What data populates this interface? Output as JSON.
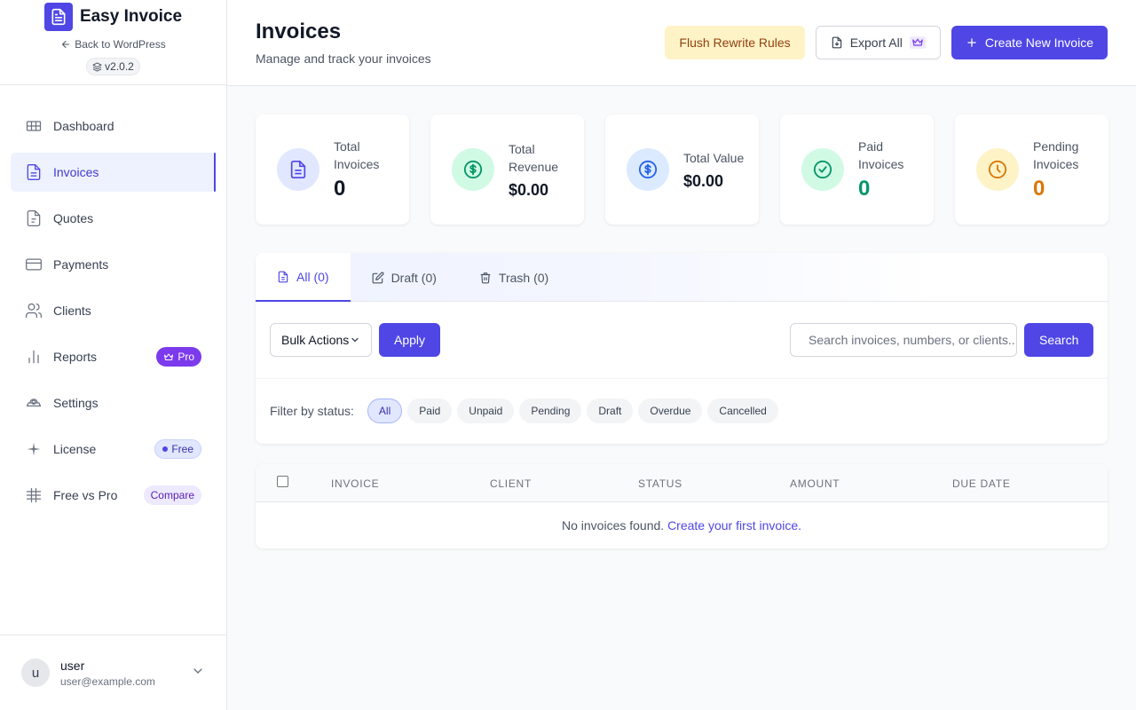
{
  "brand": {
    "name": "Easy Invoice",
    "back_label": "Back to WordPress",
    "version": "v2.0.2"
  },
  "sidebar": {
    "items": [
      {
        "label": "Dashboard",
        "icon": "dashboard-icon"
      },
      {
        "label": "Invoices",
        "icon": "invoice-icon",
        "active": true
      },
      {
        "label": "Quotes",
        "icon": "quote-icon"
      },
      {
        "label": "Payments",
        "icon": "credit-card-icon"
      },
      {
        "label": "Clients",
        "icon": "users-icon"
      },
      {
        "label": "Reports",
        "icon": "bar-chart-icon",
        "badge": "Pro"
      },
      {
        "label": "Settings",
        "icon": "settings-icon"
      },
      {
        "label": "License",
        "icon": "sparkle-icon",
        "badge": "Free"
      },
      {
        "label": "Free vs Pro",
        "icon": "grid-icon",
        "badge": "Compare"
      }
    ]
  },
  "user": {
    "initial": "u",
    "name": "user",
    "email": "user@example.com"
  },
  "header": {
    "title": "Invoices",
    "subtitle": "Manage and track your invoices",
    "flush_label": "Flush Rewrite Rules",
    "export_label": "Export All",
    "create_label": "Create New Invoice"
  },
  "stats": [
    {
      "label": "Total Invoices",
      "value": "0",
      "color": "#111827",
      "icon_bg": "#e0e7ff",
      "icon_color": "#4f46e5"
    },
    {
      "label": "Total Revenue",
      "value": "$0.00",
      "color": "#111827",
      "icon_bg": "#d1fae5",
      "icon_color": "#059669"
    },
    {
      "label": "Total Value",
      "value": "$0.00",
      "color": "#111827",
      "icon_bg": "#dbeafe",
      "icon_color": "#2563eb"
    },
    {
      "label": "Paid Invoices",
      "value": "0",
      "color": "#059669",
      "icon_bg": "#d1fae5",
      "icon_color": "#059669"
    },
    {
      "label": "Pending Invoices",
      "value": "0",
      "color": "#d97706",
      "icon_bg": "#fef3c7",
      "icon_color": "#d97706"
    }
  ],
  "tabs": [
    {
      "label": "All (0)",
      "active": true
    },
    {
      "label": "Draft (0)"
    },
    {
      "label": "Trash (0)"
    }
  ],
  "toolbar": {
    "bulk_label": "Bulk Actions",
    "apply_label": "Apply",
    "search_placeholder": "Search invoices, numbers, or clients...",
    "search_label": "Search"
  },
  "filter": {
    "label": "Filter by status:",
    "options": [
      "All",
      "Paid",
      "Unpaid",
      "Pending",
      "Draft",
      "Overdue",
      "Cancelled"
    ],
    "selected": "All"
  },
  "table": {
    "columns": [
      "INVOICE",
      "CLIENT",
      "STATUS",
      "AMOUNT",
      "DUE DATE"
    ],
    "empty_text": "No invoices found.",
    "empty_link": "Create your first invoice."
  },
  "colors": {
    "accent": "#4f46e5",
    "pro_badge": "#7c3aed"
  }
}
